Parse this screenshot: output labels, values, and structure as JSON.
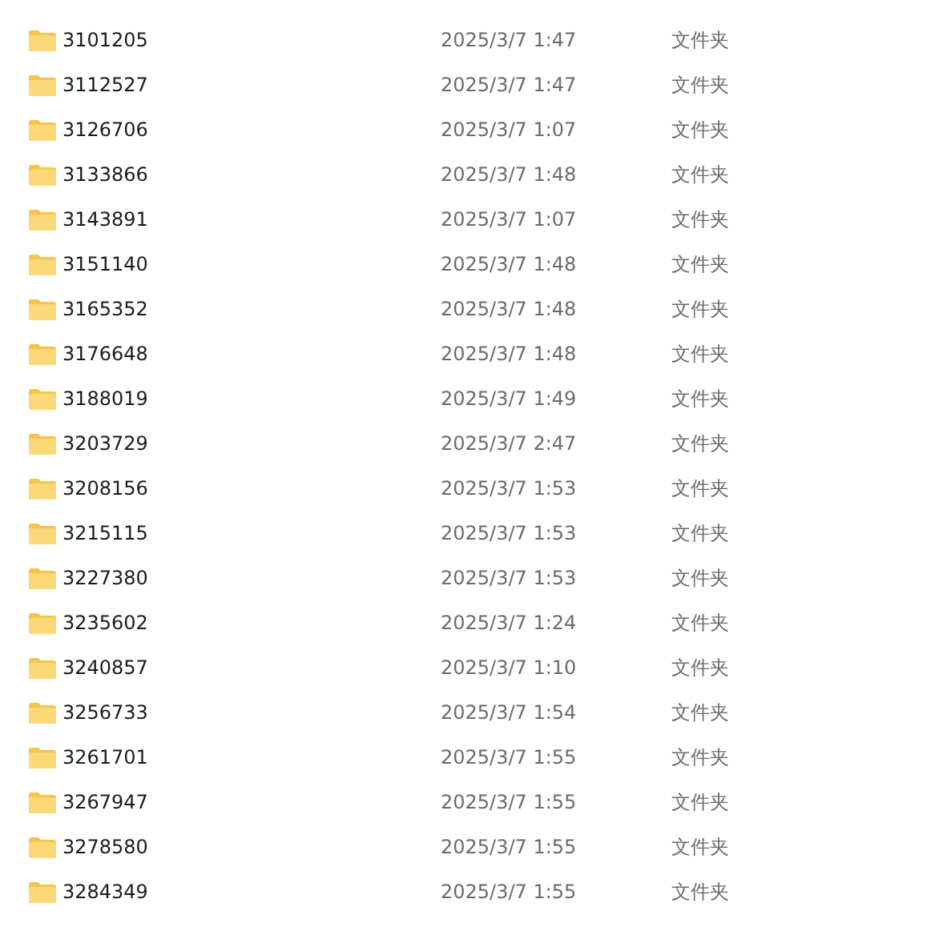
{
  "files": [
    {
      "name": "3101205",
      "modified": "2025/3/7 1:47",
      "type": "文件夹"
    },
    {
      "name": "3112527",
      "modified": "2025/3/7 1:47",
      "type": "文件夹"
    },
    {
      "name": "3126706",
      "modified": "2025/3/7 1:07",
      "type": "文件夹"
    },
    {
      "name": "3133866",
      "modified": "2025/3/7 1:48",
      "type": "文件夹"
    },
    {
      "name": "3143891",
      "modified": "2025/3/7 1:07",
      "type": "文件夹"
    },
    {
      "name": "3151140",
      "modified": "2025/3/7 1:48",
      "type": "文件夹"
    },
    {
      "name": "3165352",
      "modified": "2025/3/7 1:48",
      "type": "文件夹"
    },
    {
      "name": "3176648",
      "modified": "2025/3/7 1:48",
      "type": "文件夹"
    },
    {
      "name": "3188019",
      "modified": "2025/3/7 1:49",
      "type": "文件夹"
    },
    {
      "name": "3203729",
      "modified": "2025/3/7 2:47",
      "type": "文件夹"
    },
    {
      "name": "3208156",
      "modified": "2025/3/7 1:53",
      "type": "文件夹"
    },
    {
      "name": "3215115",
      "modified": "2025/3/7 1:53",
      "type": "文件夹"
    },
    {
      "name": "3227380",
      "modified": "2025/3/7 1:53",
      "type": "文件夹"
    },
    {
      "name": "3235602",
      "modified": "2025/3/7 1:24",
      "type": "文件夹"
    },
    {
      "name": "3240857",
      "modified": "2025/3/7 1:10",
      "type": "文件夹"
    },
    {
      "name": "3256733",
      "modified": "2025/3/7 1:54",
      "type": "文件夹"
    },
    {
      "name": "3261701",
      "modified": "2025/3/7 1:55",
      "type": "文件夹"
    },
    {
      "name": "3267947",
      "modified": "2025/3/7 1:55",
      "type": "文件夹"
    },
    {
      "name": "3278580",
      "modified": "2025/3/7 1:55",
      "type": "文件夹"
    },
    {
      "name": "3284349",
      "modified": "2025/3/7 1:55",
      "type": "文件夹"
    }
  ]
}
